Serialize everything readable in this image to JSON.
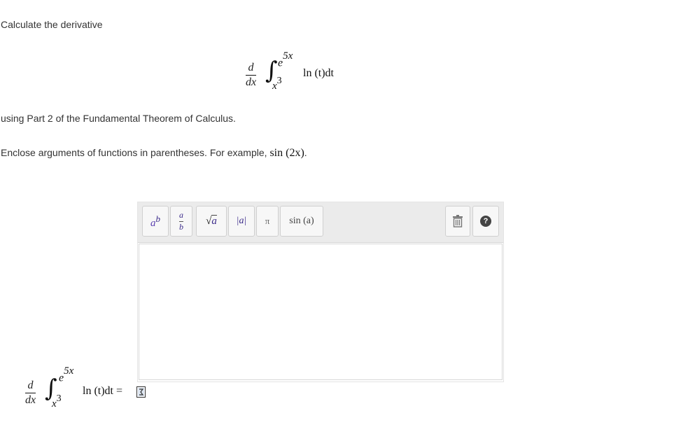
{
  "problem": {
    "instruction": "Calculate the derivative",
    "using_text": "using Part 2 of the Fundamental Theorem of Calculus.",
    "enclose_prefix": "Enclose arguments of functions in parentheses. For example, ",
    "enclose_example": "sin (2x)",
    "enclose_suffix": "."
  },
  "formula": {
    "d_numerator": "d",
    "d_denominator": "dx",
    "upper_limit_base": "e",
    "upper_limit_exp": "5x",
    "lower_limit_base": "x",
    "lower_limit_exp": "3",
    "integrand": "ln (t)dt",
    "equals": "="
  },
  "toolbar": {
    "power_label": "a^b",
    "fraction_num": "a",
    "fraction_den": "b",
    "sqrt_label": "a",
    "abs_label": "|a|",
    "pi_label": "π",
    "sin_label": "sin (a)",
    "help_label": "?"
  },
  "answer": {
    "value": ""
  }
}
